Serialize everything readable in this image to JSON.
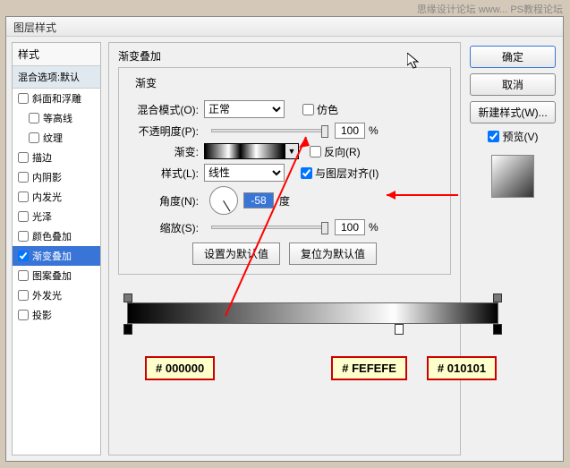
{
  "watermark": "思缘设计论坛  www... PS教程论坛",
  "dialog_title": "图层样式",
  "styles": {
    "header": "样式",
    "blend": "混合选项:默认",
    "items": [
      {
        "label": "斜面和浮雕",
        "checked": false
      },
      {
        "label": "等高线",
        "checked": false,
        "indent": true
      },
      {
        "label": "纹理",
        "checked": false,
        "indent": true
      },
      {
        "label": "描边",
        "checked": false
      },
      {
        "label": "内阴影",
        "checked": false
      },
      {
        "label": "内发光",
        "checked": false
      },
      {
        "label": "光泽",
        "checked": false
      },
      {
        "label": "颜色叠加",
        "checked": false
      },
      {
        "label": "渐变叠加",
        "checked": true,
        "selected": true
      },
      {
        "label": "图案叠加",
        "checked": false
      },
      {
        "label": "外发光",
        "checked": false
      },
      {
        "label": "投影",
        "checked": false
      }
    ]
  },
  "main": {
    "title": "渐变叠加",
    "subtitle": "渐变",
    "blend_mode_label": "混合模式(O):",
    "blend_mode_value": "正常",
    "dither_label": "仿色",
    "opacity_label": "不透明度(P):",
    "opacity_value": "100",
    "percent": "%",
    "gradient_label": "渐变:",
    "reverse_label": "反向(R)",
    "style_label": "样式(L):",
    "style_value": "线性",
    "align_label": "与图层对齐(I)",
    "angle_label": "角度(N):",
    "angle_value": "-58",
    "angle_unit": "度",
    "scale_label": "缩放(S):",
    "scale_value": "100",
    "btn_default": "设置为默认值",
    "btn_reset": "复位为默认值"
  },
  "right": {
    "ok": "确定",
    "cancel": "取消",
    "new_style": "新建样式(W)...",
    "preview": "预览(V)"
  },
  "colors": {
    "c1": "# 000000",
    "c2": "# FEFEFE",
    "c3": "# 010101"
  }
}
